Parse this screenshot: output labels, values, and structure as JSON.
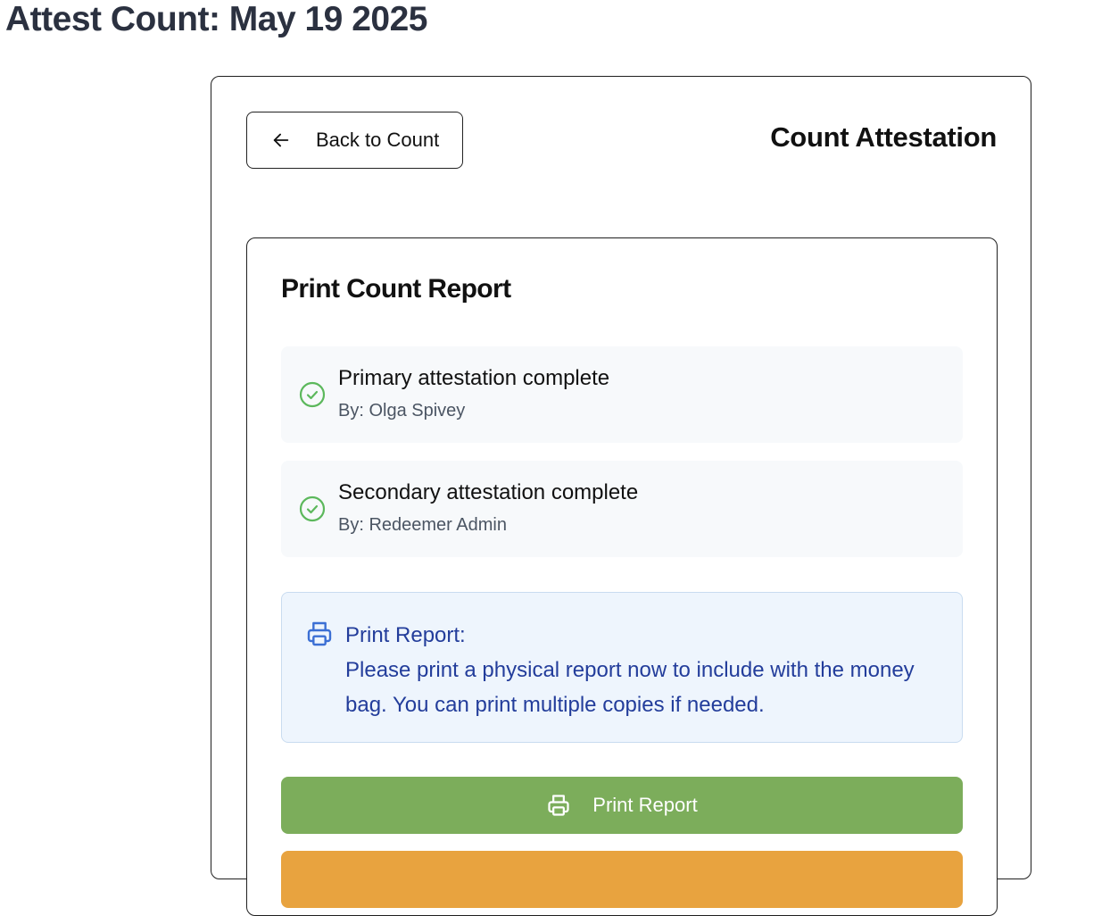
{
  "header": {
    "title": "Attest Count: May 19 2025"
  },
  "topbar": {
    "back_label": "Back to Count",
    "section_title": "Count Attestation"
  },
  "report": {
    "title": "Print Count Report",
    "attestations": [
      {
        "title": "Primary attestation complete",
        "by": "By: Olga Spivey"
      },
      {
        "title": "Secondary attestation complete",
        "by": "By: Redeemer Admin"
      }
    ],
    "notice": {
      "heading": "Print Report:",
      "body": "Please print a physical report now to include with the money bag. You can print multiple copies if needed."
    },
    "print_button": "Print Report"
  },
  "colors": {
    "success": "#5cb85c",
    "info_text": "#233d9b",
    "print_button": "#7cad5b",
    "secondary_button": "#e8a33f"
  },
  "icons": {
    "back": "arrow-left-icon",
    "check": "check-circle-icon",
    "printer": "printer-icon"
  }
}
